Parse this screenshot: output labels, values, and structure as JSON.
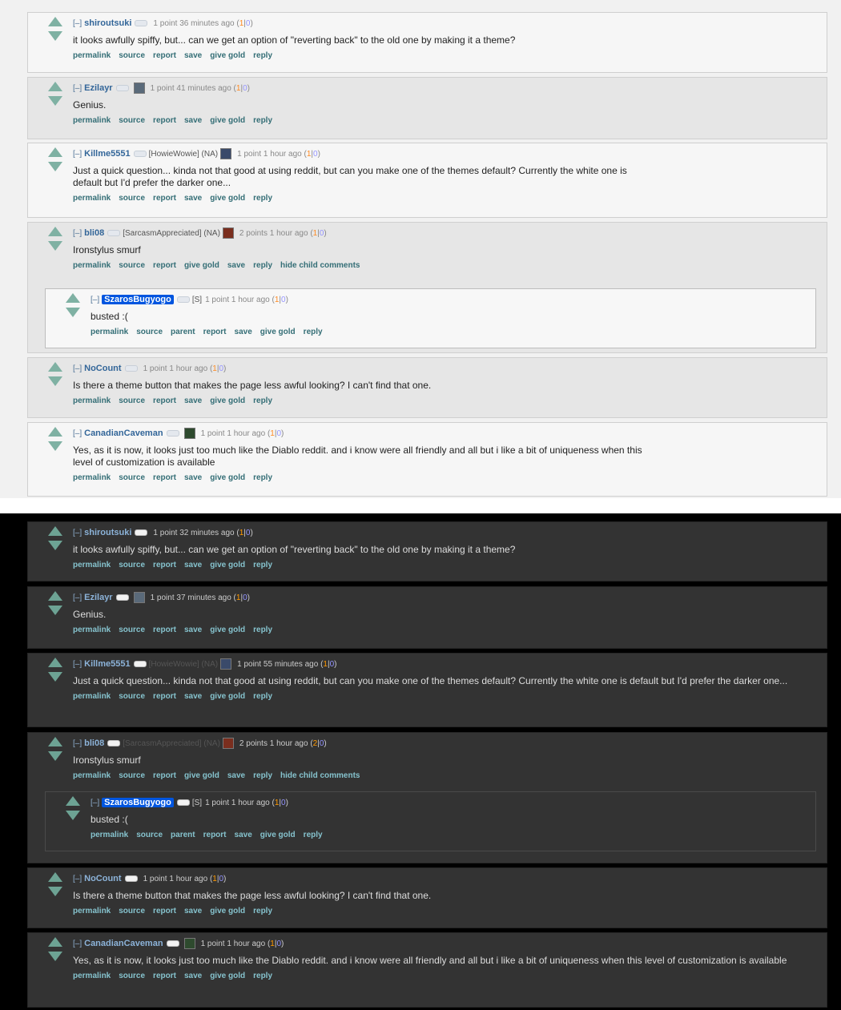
{
  "light": {
    "comments": [
      {
        "expand": "[–]",
        "author": "shiroutsuki",
        "flair": "",
        "score": "1 point 36 minutes ago",
        "ups": "1",
        "downs": "0",
        "body": "it looks awfully spiffy, but... can we get an option of \"reverting back\" to the old one by making it a theme?",
        "buttons": [
          "permalink",
          "source",
          "report",
          "save",
          "give gold",
          "reply"
        ]
      },
      {
        "expand": "[–]",
        "author": "Ezilayr",
        "flair": "",
        "score": "1 point 41 minutes ago",
        "ups": "1",
        "downs": "0",
        "body": "Genius.",
        "buttons": [
          "permalink",
          "source",
          "report",
          "save",
          "give gold",
          "reply"
        ]
      },
      {
        "expand": "[–]",
        "author": "Killme5551",
        "flair": "[HowieWowie] (NA)",
        "score": "1 point 1 hour ago",
        "ups": "1",
        "downs": "0",
        "body": "Just a quick question... kinda not that good at using reddit, but can you make one of the themes default? Currently the white one is default but I'd prefer the darker one...",
        "buttons": [
          "permalink",
          "source",
          "report",
          "save",
          "give gold",
          "reply"
        ]
      },
      {
        "expand": "[–]",
        "author": "bli08",
        "flair": "[SarcasmAppreciated] (NA)",
        "score": "2 points 1 hour ago",
        "ups": "1",
        "downs": "0",
        "body": "Ironstylus smurf",
        "buttons": [
          "permalink",
          "source",
          "report",
          "give gold",
          "save",
          "reply",
          "hide child comments"
        ]
      },
      {
        "expand": "[–]",
        "author": "SzarosBugyogo",
        "flair": "[S]",
        "score": "1 point 1 hour ago",
        "ups": "1",
        "downs": "0",
        "body": "busted :(",
        "buttons": [
          "permalink",
          "source",
          "parent",
          "report",
          "save",
          "give gold",
          "reply"
        ]
      },
      {
        "expand": "[–]",
        "author": "NoCount",
        "flair": "",
        "score": "1 point 1 hour ago",
        "ups": "1",
        "downs": "0",
        "body": "Is there a theme button that makes the page less awful looking? I can't find that one.",
        "buttons": [
          "permalink",
          "source",
          "report",
          "save",
          "give gold",
          "reply"
        ]
      },
      {
        "expand": "[–]",
        "author": "CanadianCaveman",
        "flair": "",
        "score": "1 point 1 hour ago",
        "ups": "1",
        "downs": "0",
        "body": "Yes, as it is now, it looks just too much like the Diablo reddit. and i know were all friendly and all but i like a bit of uniqueness when this level of customization is available",
        "buttons": [
          "permalink",
          "source",
          "report",
          "save",
          "give gold",
          "reply"
        ]
      }
    ]
  },
  "dark": {
    "comments": [
      {
        "expand": "[–]",
        "author": "shiroutsuki",
        "flair": "",
        "score": "1 point 32 minutes ago",
        "ups": "1",
        "downs": "0",
        "body": "it looks awfully spiffy, but... can we get an option of \"reverting back\" to the old one by making it a theme?",
        "buttons": [
          "permalink",
          "source",
          "report",
          "save",
          "give gold",
          "reply"
        ]
      },
      {
        "expand": "[–]",
        "author": "Ezilayr",
        "flair": "",
        "score": "1 point 37 minutes ago",
        "ups": "1",
        "downs": "0",
        "body": "Genius.",
        "buttons": [
          "permalink",
          "source",
          "report",
          "save",
          "give gold",
          "reply"
        ]
      },
      {
        "expand": "[–]",
        "author": "Killme5551",
        "flair": "[HowieWowie] (NA)",
        "score": "1 point 55 minutes ago",
        "ups": "1",
        "downs": "0",
        "body": "Just a quick question... kinda not that good at using reddit, but can you make one of the themes default? Currently the white one is default but I'd prefer the darker one...",
        "buttons": [
          "permalink",
          "source",
          "report",
          "save",
          "give gold",
          "reply"
        ]
      },
      {
        "expand": "[–]",
        "author": "bli08",
        "flair": "[SarcasmAppreciated] (NA)",
        "score": "2 points 1 hour ago",
        "ups": "2",
        "downs": "0",
        "body": "Ironstylus smurf",
        "buttons": [
          "permalink",
          "source",
          "report",
          "give gold",
          "save",
          "reply",
          "hide child comments"
        ]
      },
      {
        "expand": "[–]",
        "author": "SzarosBugyogo",
        "flair": "[S]",
        "score": "1 point 1 hour ago",
        "ups": "1",
        "downs": "0",
        "body": "busted :(",
        "buttons": [
          "permalink",
          "source",
          "parent",
          "report",
          "save",
          "give gold",
          "reply"
        ]
      },
      {
        "expand": "[–]",
        "author": "NoCount",
        "flair": "",
        "score": "1 point 1 hour ago",
        "ups": "1",
        "downs": "0",
        "body": "Is there a theme button that makes the page less awful looking? I can't find that one.",
        "buttons": [
          "permalink",
          "source",
          "report",
          "save",
          "give gold",
          "reply"
        ]
      },
      {
        "expand": "[–]",
        "author": "CanadianCaveman",
        "flair": "",
        "score": "1 point 1 hour ago",
        "ups": "1",
        "downs": "0",
        "body": "Yes, as it is now, it looks just too much like the Diablo reddit. and i know were all friendly and all but i like a bit of uniqueness when this level of customization is available",
        "buttons": [
          "permalink",
          "source",
          "report",
          "save",
          "give gold",
          "reply"
        ]
      }
    ]
  },
  "colors": {
    "upvote_arrow": "#7fb1a3",
    "op_highlight": "#0055df",
    "upvote_count": "#ff8b24",
    "downvote_count": "#9494ff"
  },
  "icons": {
    "upvote": "upvote-arrow-icon",
    "downvote": "downvote-arrow-icon",
    "avatar": "avatar-icon",
    "user-pill": "user-pill-icon"
  }
}
